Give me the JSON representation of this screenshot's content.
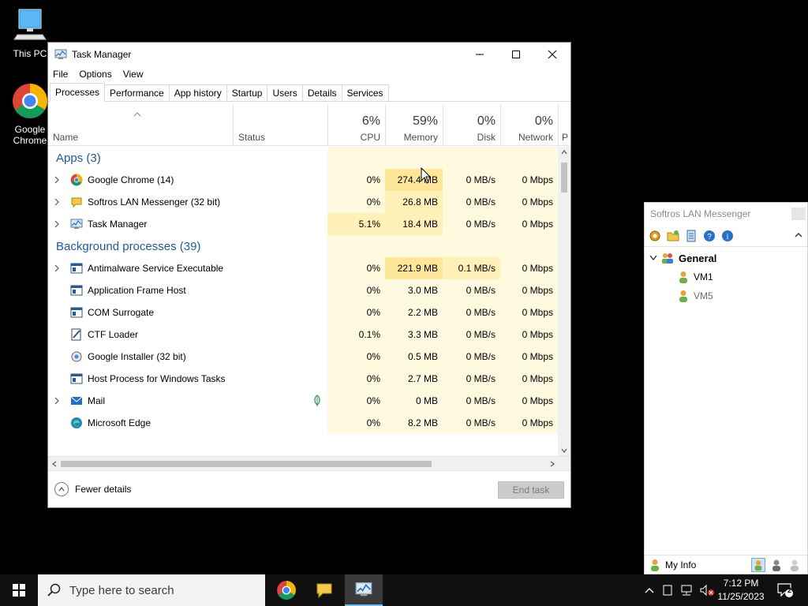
{
  "desktop": {
    "icons": [
      {
        "label": "This PC",
        "icon": "computer-icon"
      },
      {
        "label": "Google Chrome",
        "icon": "chrome-icon"
      }
    ]
  },
  "task_manager": {
    "title": "Task Manager",
    "menu": [
      "File",
      "Options",
      "View"
    ],
    "tabs": [
      "Processes",
      "Performance",
      "App history",
      "Startup",
      "Users",
      "Details",
      "Services"
    ],
    "active_tab": "Processes",
    "columns": {
      "name": "Name",
      "status": "Status",
      "cpu": {
        "percent": "6%",
        "label": "CPU"
      },
      "memory": {
        "percent": "59%",
        "label": "Memory"
      },
      "disk": {
        "percent": "0%",
        "label": "Disk"
      },
      "network": {
        "percent": "0%",
        "label": "Network"
      },
      "power_cut": "P"
    },
    "groups": [
      {
        "title": "Apps (3)",
        "rows": [
          {
            "name": "Google Chrome (14)",
            "icon": "chrome-icon",
            "expandable": true,
            "cpu": "0%",
            "memory": "274.4 MB",
            "disk": "0 MB/s",
            "network": "0 Mbps"
          },
          {
            "name": "Softros LAN Messenger (32 bit)",
            "icon": "messenger-icon",
            "expandable": true,
            "cpu": "0%",
            "memory": "26.8 MB",
            "disk": "0 MB/s",
            "network": "0 Mbps"
          },
          {
            "name": "Task Manager",
            "icon": "task-manager-icon",
            "expandable": true,
            "cpu": "5.1%",
            "memory": "18.4 MB",
            "disk": "0 MB/s",
            "network": "0 Mbps"
          }
        ]
      },
      {
        "title": "Background processes (39)",
        "rows": [
          {
            "name": "Antimalware Service Executable",
            "icon": "service-icon",
            "expandable": true,
            "cpu": "0%",
            "memory": "221.9 MB",
            "disk": "0.1 MB/s",
            "network": "0 Mbps"
          },
          {
            "name": "Application Frame Host",
            "icon": "service-icon",
            "expandable": false,
            "cpu": "0%",
            "memory": "3.0 MB",
            "disk": "0 MB/s",
            "network": "0 Mbps"
          },
          {
            "name": "COM Surrogate",
            "icon": "service-icon",
            "expandable": false,
            "cpu": "0%",
            "memory": "2.2 MB",
            "disk": "0 MB/s",
            "network": "0 Mbps"
          },
          {
            "name": "CTF Loader",
            "icon": "ctf-icon",
            "expandable": false,
            "cpu": "0.1%",
            "memory": "3.3 MB",
            "disk": "0 MB/s",
            "network": "0 Mbps"
          },
          {
            "name": "Google Installer (32 bit)",
            "icon": "installer-icon",
            "expandable": false,
            "cpu": "0%",
            "memory": "0.5 MB",
            "disk": "0 MB/s",
            "network": "0 Mbps"
          },
          {
            "name": "Host Process for Windows Tasks",
            "icon": "service-icon",
            "expandable": false,
            "cpu": "0%",
            "memory": "2.7 MB",
            "disk": "0 MB/s",
            "network": "0 Mbps"
          },
          {
            "name": "Mail",
            "icon": "mail-icon",
            "expandable": true,
            "suspended": true,
            "cpu": "0%",
            "memory": "0 MB",
            "disk": "0 MB/s",
            "network": "0 Mbps"
          },
          {
            "name": "Microsoft Edge",
            "icon": "edge-icon",
            "expandable": false,
            "cpu": "0%",
            "memory": "8.2 MB",
            "disk": "0 MB/s",
            "network": "0 Mbps"
          }
        ]
      }
    ],
    "fewer_details": "Fewer details",
    "end_task": "End task"
  },
  "lan_messenger": {
    "title": "Softros LAN Messenger",
    "group": "General",
    "users": [
      "VM1",
      "VM5"
    ],
    "my_info": "My Info"
  },
  "taskbar": {
    "search_placeholder": "Type here to search",
    "time": "7:12 PM",
    "date": "11/25/2023",
    "notification_count": "2"
  },
  "colors": {
    "heat_low": "#fff9e0",
    "heat_mid": "#fff1b8",
    "heat_high": "#ffe79a",
    "group_title": "#1f5a9e",
    "taskbar": "#101010"
  }
}
